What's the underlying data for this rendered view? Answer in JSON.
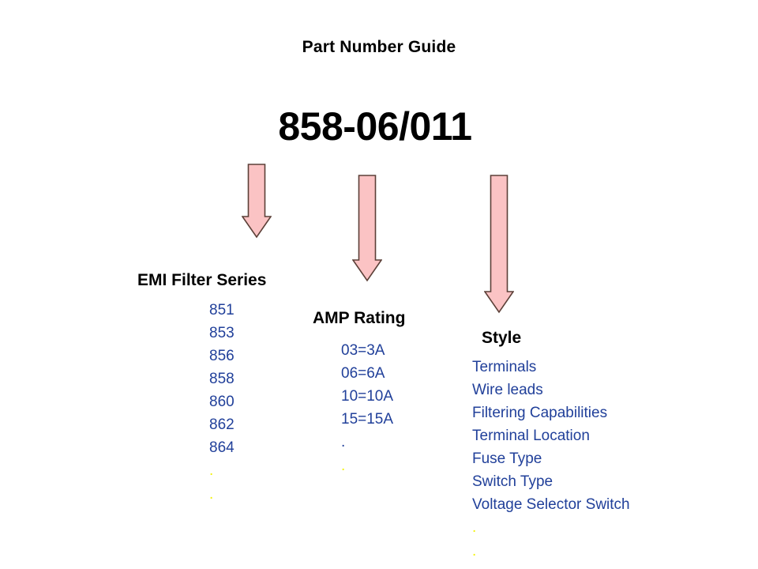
{
  "page": {
    "title": "Part Number Guide",
    "part_number": "858-06/011",
    "background_color": "#FFFFFF",
    "text_color_heading": "#000000",
    "text_color_list": "#21409A",
    "arrow_fill_color": "#FBC3C4",
    "arrow_outline_color": "#5C4038",
    "dot_color_yellow": "#F2F20A"
  },
  "columns": [
    {
      "id": "emi-filter-series",
      "header": "EMI Filter Series",
      "items": [
        {
          "label": "851",
          "kind": "value"
        },
        {
          "label": "853",
          "kind": "value"
        },
        {
          "label": "856",
          "kind": "value"
        },
        {
          "label": "858",
          "kind": "value"
        },
        {
          "label": "860",
          "kind": "value"
        },
        {
          "label": "862",
          "kind": "value"
        },
        {
          "label": "864",
          "kind": "value"
        },
        {
          "label": ".",
          "kind": "dot-yellow"
        },
        {
          "label": ".",
          "kind": "dot-yellow"
        }
      ]
    },
    {
      "id": "amp-rating",
      "header": "AMP Rating",
      "items": [
        {
          "label": "03=3A",
          "kind": "value"
        },
        {
          "label": "06=6A",
          "kind": "value"
        },
        {
          "label": "10=10A",
          "kind": "value"
        },
        {
          "label": "15=15A",
          "kind": "value"
        },
        {
          "label": ".",
          "kind": "dot-blue"
        },
        {
          "label": ".",
          "kind": "dot-yellow"
        }
      ]
    },
    {
      "id": "style",
      "header": "Style",
      "items": [
        {
          "label": "Terminals",
          "kind": "value"
        },
        {
          "label": "Wire leads",
          "kind": "value"
        },
        {
          "label": "Filtering Capabilities",
          "kind": "value"
        },
        {
          "label": "Terminal Location",
          "kind": "value"
        },
        {
          "label": "Fuse Type",
          "kind": "value"
        },
        {
          "label": "Switch Type",
          "kind": "value"
        },
        {
          "label": "Voltage Selector Switch",
          "kind": "value"
        },
        {
          "label": ".",
          "kind": "dot-yellow"
        },
        {
          "label": ".",
          "kind": "dot-yellow"
        }
      ]
    }
  ],
  "arrows": [
    {
      "id": "arrow-to-emi-filter-series",
      "points_to": "EMI Filter Series",
      "length": 93
    },
    {
      "id": "arrow-to-amp-rating",
      "points_to": "AMP Rating",
      "length": 134
    },
    {
      "id": "arrow-to-style",
      "points_to": "Style",
      "length": 174
    }
  ]
}
